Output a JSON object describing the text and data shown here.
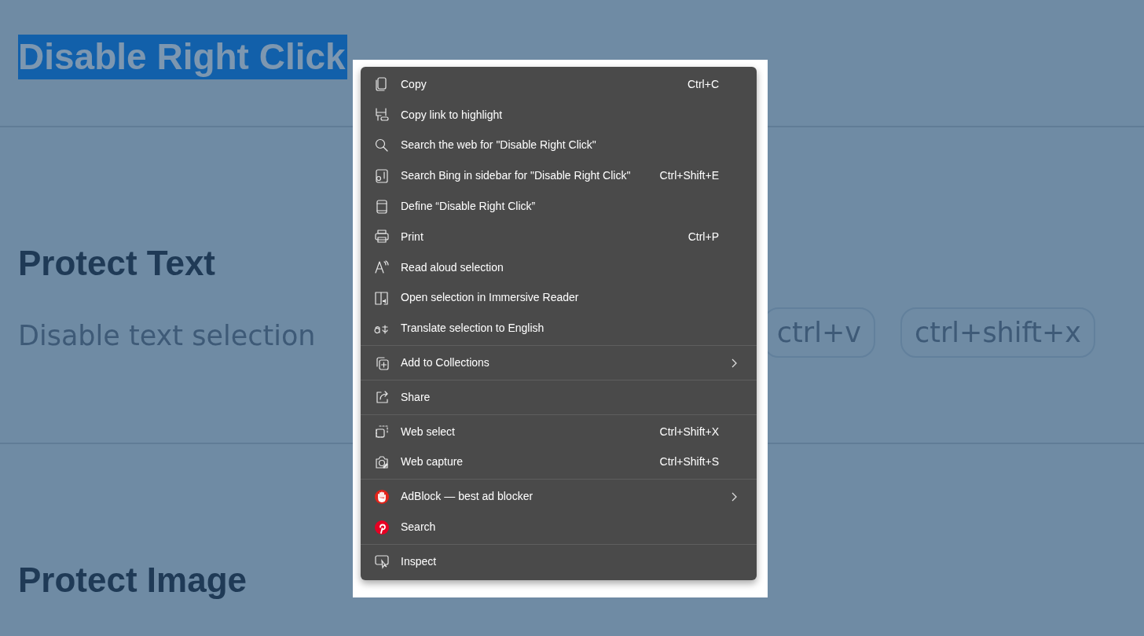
{
  "page": {
    "title": "Disable Right Click",
    "title_selected": true,
    "sections": [
      {
        "heading": "Protect Text",
        "description": "Disable text selection",
        "shortcuts": [
          "ctrl+v",
          "ctrl+shift+x"
        ]
      },
      {
        "heading": "Protect Image"
      }
    ]
  },
  "context_menu": {
    "groups": [
      {
        "items": [
          {
            "label": "Copy",
            "shortcut": "Ctrl+C",
            "submenu": false
          },
          {
            "label": "Copy link to highlight",
            "submenu": false
          },
          {
            "label": "Search the web for \"Disable Right Click\"",
            "submenu": false
          },
          {
            "label": "Search Bing in sidebar for \"Disable Right Click\"",
            "shortcut": "Ctrl+Shift+E",
            "submenu": false
          },
          {
            "label": "Define “Disable Right Click”",
            "submenu": false
          },
          {
            "label": "Print",
            "shortcut": "Ctrl+P",
            "submenu": false
          },
          {
            "label": "Read aloud selection",
            "submenu": false
          },
          {
            "label": "Open selection in Immersive Reader",
            "submenu": false
          },
          {
            "label": "Translate selection to English",
            "submenu": false
          }
        ]
      },
      {
        "items": [
          {
            "label": "Add to Collections",
            "submenu": true
          }
        ]
      },
      {
        "items": [
          {
            "label": "Share",
            "submenu": false
          }
        ]
      },
      {
        "items": [
          {
            "label": "Web select",
            "shortcut": "Ctrl+Shift+X",
            "submenu": false
          },
          {
            "label": "Web capture",
            "shortcut": "Ctrl+Shift+S",
            "submenu": false
          }
        ]
      },
      {
        "items": [
          {
            "label": "AdBlock — best ad blocker",
            "submenu": true
          },
          {
            "label": "Search",
            "submenu": false
          }
        ]
      },
      {
        "items": [
          {
            "label": "Inspect",
            "submenu": false
          }
        ]
      }
    ]
  }
}
